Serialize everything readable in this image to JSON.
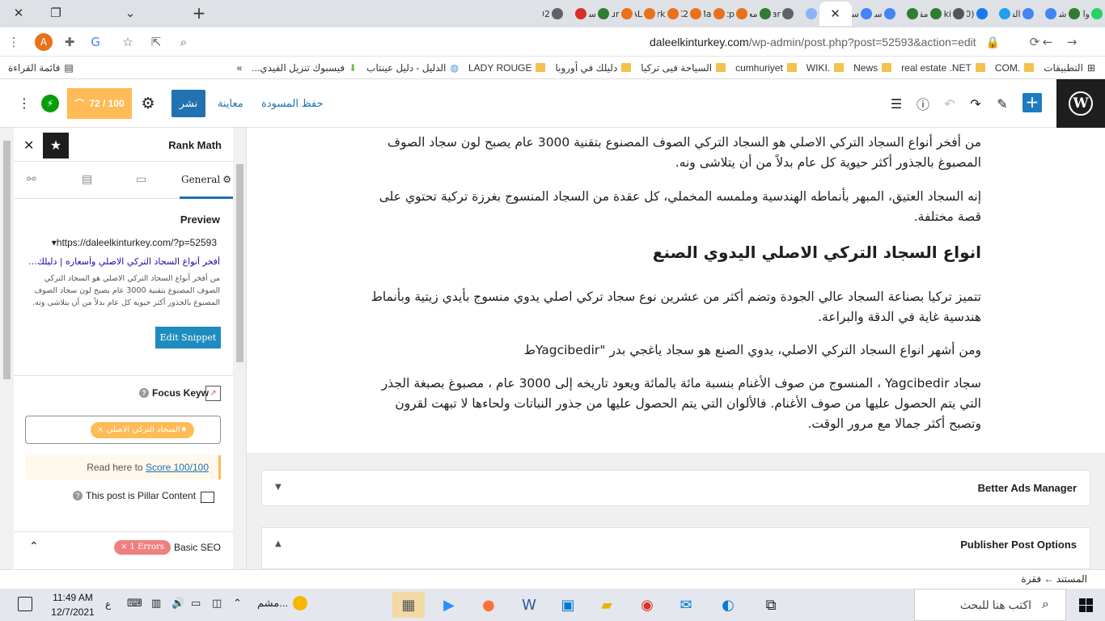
{
  "browser": {
    "tabs": [
      {
        "label": "واتـ",
        "color": "#25d366"
      },
      {
        "label": "شري",
        "color": "#2e7d32"
      },
      {
        "label": "",
        "color": "#4285f4"
      },
      {
        "label": "الس",
        "color": "#4285f4"
      },
      {
        "label": "",
        "color": "#1da1f2"
      },
      {
        "label": "(20",
        "color": "#1877f2"
      },
      {
        "label": "İki",
        "color": "#555555"
      },
      {
        "label": "مقا",
        "color": "#2e7d32"
      },
      {
        "label": "",
        "color": "#2e7d32"
      },
      {
        "label": "سح",
        "color": "#4285f4"
      },
      {
        "label": "سح",
        "color": "#4285f4"
      },
      {
        "label": "",
        "color": "#8ab4f8"
      },
      {
        "label": "Car",
        "color": "#5f6368"
      },
      {
        "label": "معا",
        "color": "#2e7d32"
      },
      {
        "label": "http",
        "color": "#e8711a"
      },
      {
        "label": "Ma",
        "color": "#e8711a"
      },
      {
        "label": "EK2",
        "color": "#e8711a"
      },
      {
        "label": "Erk",
        "color": "#e8711a"
      },
      {
        "label": "SAL",
        "color": "#e8711a"
      },
      {
        "label": "Lur",
        "color": "#e8711a"
      },
      {
        "label": "سح",
        "color": "#2e7d32"
      },
      {
        "label": "",
        "color": "#d93025"
      },
      {
        "label": "202",
        "color": "#5f6368"
      }
    ],
    "active_tab_close": "✕",
    "new_tab": "+",
    "url_host": "daleelkinturkey.com",
    "url_path": "/wp-admin/post.php?post=52593&action=edit",
    "avatar_letter": "A"
  },
  "bookmarks": [
    {
      "label": "التطبيقات",
      "icon": "apps-grid-icon"
    },
    {
      "label": ".COM",
      "icon": "folder-icon"
    },
    {
      "label": "real estate .NET",
      "icon": "folder-icon"
    },
    {
      "label": "News",
      "icon": "folder-icon"
    },
    {
      "label": ".WIKI",
      "icon": "folder-icon"
    },
    {
      "label": "cumhuriyet",
      "icon": "folder-icon"
    },
    {
      "label": "السياحة فيى تركيا",
      "icon": "folder-icon"
    },
    {
      "label": "دليلك في أوروبا",
      "icon": "folder-icon"
    },
    {
      "label": "LADY ROUGE",
      "icon": "folder-icon"
    },
    {
      "label": "الدليل - دليل عينتاب",
      "icon": "globe-icon"
    },
    {
      "label": "فيسبوك تنزيل الفيدي...",
      "icon": "download-icon"
    }
  ],
  "bookmarks_more": "»",
  "reading_list": "قائمة القراءة",
  "wp": {
    "save_draft": "حفظ المسودة",
    "preview": "معاينة",
    "publish": "نشر",
    "score": "72 / 100"
  },
  "rankmath": {
    "title": "Rank Math",
    "general_tab": "General",
    "preview_title": "Preview",
    "snippet_url": "https://daleelkinturkey.com/?p=52593",
    "snippet_title": "أفخر أنواع السجاد التركي الاصلي وأسعاره | دليلك في تركيا",
    "snippet_desc": "من أفخر أنواع السجاد التركي الاصلي هو السجاد التركي الصوف المصنوع بتقنية 3000 عام يصبح لون سجاد الصوف المصبوغ بالجذور أكثر حيوية كل عام بدلاً من أن يتلاشى ونه.",
    "edit_snippet": "Edit Snippet",
    "focus_keyword_label": "Focus Keyw",
    "focus_keyword_chip": "★السجاد التركي الاصلي ×",
    "read_here": "Read here to",
    "score_link": "Score 100/100",
    "pillar_label": "This post is Pillar Content",
    "basic_seo": "Basic SEO",
    "errors_badge": "× 1 Errors"
  },
  "editor": {
    "paragraphs": [
      "من أفخر أنواع السجاد التركي الاصلي هو السجاد التركي الصوف المصنوع بتقنية 3000 عام يصبح لون سجاد الصوف المصبوغ بالجذور أكثر حيوية كل عام بدلاً من أن يتلاشى ونه.",
      "إنه السجاد العتيق، المبهر بأنماطه الهندسية وملمسه المخملي، كل عقدة من السجاد المنسوج بغرزة تركية تحتوي على قصة مختلفة."
    ],
    "heading": "انواع السجاد التركي الاصلي اليدوي الصنع",
    "paragraphs_after": [
      "تتميز تركيا بصناعة السجاد عالي الجودة وتضم أكثر من عشرين نوع سجاد تركي اصلي يدوي منسوج بأيدي زيتية وبأنماط هندسية غاية في الدقة والبراعة.",
      "ومن أشهر انواع السجاد التركي الاصلي، يدوي الصنع هو سجاد ياغجي بدر \"Yagcibedirط",
      "سجاد Yagcibedir ، المنسوج من صوف الأغنام بنسبة مائة بالمائة ويعود تاريخه إلى 3000 عام ، مصبوغ بصبغة الجذر التي يتم الحصول عليها من صوف الأغنام. فالألوان التي يتم الحصول عليها من جذور النباتات ولحاءها لا تبهت لقرون وتصبح أكثر جمالا مع مرور الوقت."
    ]
  },
  "panels": {
    "better_ads": "Better Ads Manager",
    "publisher": "Publisher Post Options"
  },
  "breadcrumb": {
    "document": "المستند",
    "arrow": "←",
    "paragraph": "فقرة"
  },
  "taskbar": {
    "search_placeholder": "اكتب هنا للبحث",
    "time": "11:49 AM",
    "date": "12/7/2021",
    "lang": "ع",
    "weather": "مشم..."
  }
}
